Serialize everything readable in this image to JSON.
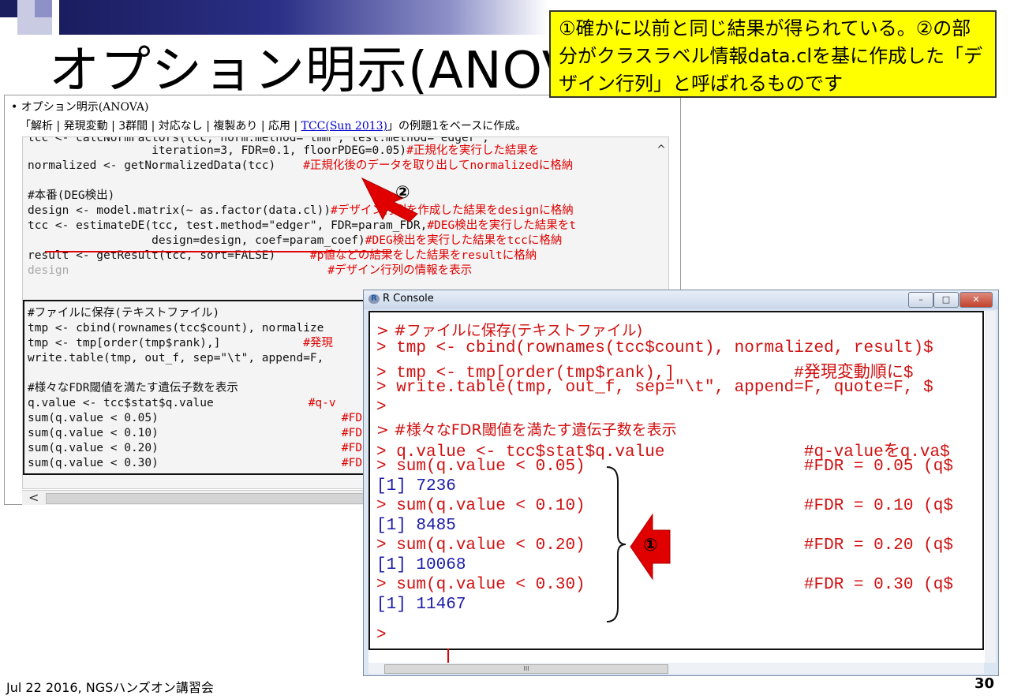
{
  "slide": {
    "title": "オプション明示(ANOVA",
    "callout": "①確かに以前と同じ結果が得られている。②の部分がクラスラベル情報data.clを基に作成した「デザイン行列」と呼ばれるものです",
    "footer_left": "Jul 22 2016, NGSハンズオン講習会",
    "page_number": "30",
    "colors": {
      "title_bar_dark": "#1a1d5e",
      "callout_bg": "#ffff00",
      "code_comment": "#e00000",
      "r_output": "#1a1aa8"
    }
  },
  "left_window": {
    "bullet": "• オプション明示(ANOVA)",
    "breadcrumb_text": "「解析 | 発現変動 | 3群間 | 対応なし | 複製あり | 応用 | ",
    "breadcrumb_link": "TCC(Sun 2013)",
    "breadcrumb_tail": "」の例題1をベースに作成。",
    "code_lines": [
      "                  iteration=3, FDR=0.1, floorPDEG=0.05)",
      "normalized <- getNormalizedData(tcc)    ",
      "#本番(DEG検出)",
      "design <- model.matrix(~ as.factor(data.cl))",
      "tcc <- estimateDE(tcc, test.method=\"edger\", FDR=param_FDR,",
      "                  design=design, coef=param_coef)",
      "result <- getResult(tcc, sort=FALSE)     ",
      "design",
      "#ファイルに保存(テキストファイル)",
      "tmp <- cbind(rownames(tcc$count), normalize",
      "tmp <- tmp[order(tmp$rank),]            ",
      "write.table(tmp, out_f, sep=\"\\t\", append=F,",
      "#様々なFDR閾値を満たす遺伝子数を表示",
      "q.value <- tcc$stat$q.value",
      "sum(q.value < 0.05)",
      "sum(q.value < 0.10)",
      "sum(q.value < 0.20)",
      "sum(q.value < 0.30)"
    ],
    "code_comments": [
      "#正規化を実行した結果を",
      "#正規化後のデータを取り出してnormalizedに格納",
      "#デザイン行列を作成した結果をdesignに格納",
      "#DEG検出を実行した結果をt",
      "#DEG検出を実行した結果をtccに格納",
      "#p値などの結果をした結果をresultに格納",
      "#デザイン行列の情報を表示",
      "#発現",
      "#q-v",
      "#FDR"
    ],
    "marker_2": "②"
  },
  "r_console": {
    "title": "R Console",
    "lines": [
      "> #ファイルに保存(テキストファイル)",
      "> tmp <- cbind(rownames(tcc$count), normalized, result)$",
      "> tmp <- tmp[order(tmp$rank),]            #発現変動順に$",
      "> write.table(tmp, out_f, sep=\"\\t\", append=F, quote=F, $",
      ">",
      "> #様々なFDR閾値を満たす遺伝子数を表示",
      "> q.value <- tcc$stat$q.value              #q-valueをq.va$",
      "> sum(q.value < 0.05)                      #FDR = 0.05 (q$",
      "[1] 7236",
      "> sum(q.value < 0.10)                      #FDR = 0.10 (q$",
      "[1] 8485",
      "> sum(q.value < 0.20)                      #FDR = 0.20 (q$",
      "[1] 10068",
      "> sum(q.value < 0.30)                      #FDR = 0.30 (q$",
      "[1] 11467",
      ">"
    ],
    "marker_1": "①",
    "scroll_thumb": "III",
    "window_buttons": [
      "minimize",
      "maximize",
      "close"
    ]
  }
}
